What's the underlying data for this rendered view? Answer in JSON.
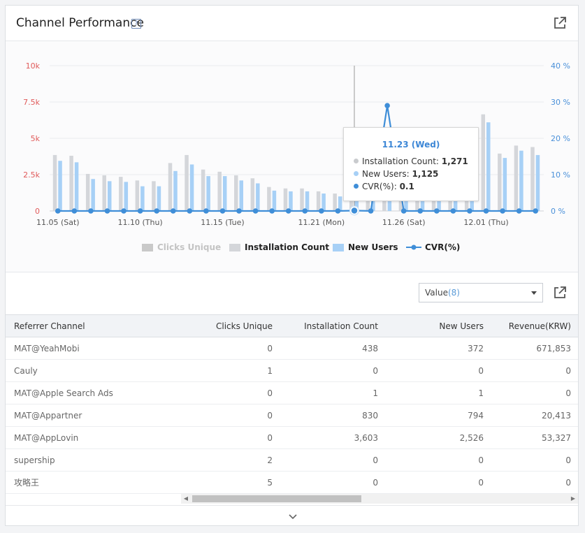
{
  "panel": {
    "title": "Channel Performance",
    "help_glyph": "?"
  },
  "colors": {
    "clicks": "#cfcfcf",
    "install": "#d4d6da",
    "new_users": "#a7d0f6",
    "cvr": "#3f8ed8",
    "left_axis": "#e05a5a",
    "right_axis": "#4a90d9"
  },
  "chart_data": {
    "type": "bar",
    "x_tick_labels": [
      "11.05 (Sat)",
      "11.10 (Thu)",
      "11.15 (Tue)",
      "11.21 (Mon)",
      "11.26 (Sat)",
      "12.01 (Thu)"
    ],
    "y_left_ticks": [
      "10k",
      "7.5k",
      "5k",
      "2.5k",
      "0"
    ],
    "y_right_ticks": [
      "40 %",
      "30 %",
      "20 %",
      "10 %",
      "0 %"
    ],
    "ylim_left": [
      0,
      10000
    ],
    "ylim_right": [
      0,
      40
    ],
    "legend_position": "bottom-center",
    "legend": [
      {
        "name": "Clicks Unique",
        "style": "bar",
        "inactive": true
      },
      {
        "name": "Installation Count",
        "style": "bar"
      },
      {
        "name": "New Users",
        "style": "bar"
      },
      {
        "name": "CVR(%)",
        "style": "line"
      }
    ],
    "series": [
      {
        "name": "Installation Count",
        "axis": "left",
        "values": [
          3850,
          3800,
          2550,
          2450,
          2350,
          2100,
          2050,
          3300,
          3850,
          2850,
          2700,
          2450,
          2250,
          1650,
          1550,
          1550,
          1350,
          1200,
          1271,
          1200,
          1150,
          1100,
          1050,
          1050,
          1000,
          1600,
          6650,
          3950,
          4500,
          4400
        ]
      },
      {
        "name": "New Users",
        "axis": "left",
        "values": [
          3450,
          3350,
          2200,
          2050,
          2000,
          1700,
          1700,
          2750,
          3200,
          2400,
          2400,
          2100,
          1900,
          1400,
          1350,
          1350,
          1200,
          1000,
          1125,
          1050,
          1000,
          950,
          950,
          950,
          900,
          1500,
          6100,
          3650,
          4150,
          3850
        ]
      },
      {
        "name": "CVR(%)",
        "axis": "right",
        "values": [
          0,
          0,
          0,
          0,
          0,
          0,
          0,
          0,
          0,
          0,
          0,
          0,
          0,
          0,
          0,
          0,
          0,
          0,
          0.1,
          0,
          29,
          0,
          0,
          0,
          0,
          0,
          0,
          0,
          0,
          0
        ]
      }
    ],
    "highlight": {
      "date": "11.23 (Wed)",
      "rows": [
        {
          "label": "Installation Count: ",
          "value": "1,271"
        },
        {
          "label": "New Users: ",
          "value": "1,125"
        },
        {
          "label": "CVR(%): ",
          "value": "0.1"
        }
      ]
    }
  },
  "controls": {
    "select_prefix": "Value",
    "select_count": "(8)"
  },
  "table": {
    "columns": [
      "Referrer Channel",
      "Clicks Unique",
      "Installation Count",
      "New Users",
      "Revenue(KRW)"
    ],
    "rows": [
      [
        "MAT@YeahMobi",
        "0",
        "438",
        "372",
        "671,853"
      ],
      [
        "Cauly",
        "1",
        "0",
        "0",
        "0"
      ],
      [
        "MAT@Apple Search Ads",
        "0",
        "1",
        "1",
        "0"
      ],
      [
        "MAT@Appartner",
        "0",
        "830",
        "794",
        "20,413"
      ],
      [
        "MAT@AppLovin",
        "0",
        "3,603",
        "2,526",
        "53,327"
      ],
      [
        "supership",
        "2",
        "0",
        "0",
        "0"
      ],
      [
        "攻略王",
        "5",
        "0",
        "0",
        "0"
      ]
    ]
  }
}
